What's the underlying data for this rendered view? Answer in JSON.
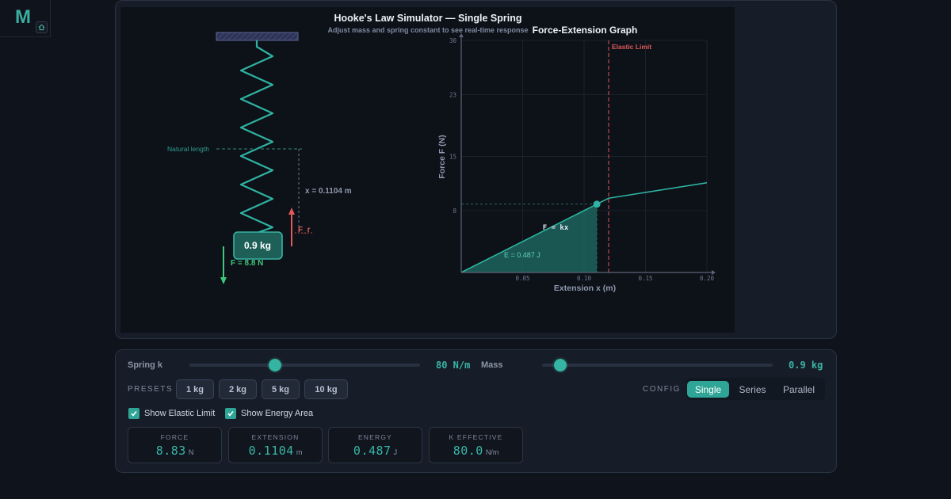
{
  "app": {
    "logo_letter": "M",
    "home_icon": "home-icon"
  },
  "simulation": {
    "title": "Hooke's Law Simulator — Single Spring",
    "subtitle": "Adjust mass and spring constant to see real-time response",
    "natural_length_label": "Natural length",
    "extension_label": "x = 0.1104 m",
    "restoring_force_label": "F_r",
    "mass_label": "0.9 kg",
    "weight_label": "F = 8.8 N",
    "colors": {
      "spring": "#2fb3a2",
      "restoring": "#e05a5a",
      "weight": "#3ec97a",
      "ceiling": "#3a4266"
    }
  },
  "graph": {
    "title": "Force-Extension Graph",
    "xlabel": "Extension x (m)",
    "ylabel": "Force F (N)",
    "elastic_limit_label": "Elastic Limit",
    "formula_label": "F = kx",
    "energy_label": "E = 0.487 J"
  },
  "chart_data": {
    "type": "line",
    "title": "Force-Extension Graph",
    "xlabel": "Extension x (m)",
    "ylabel": "Force F (N)",
    "xlim": [
      0,
      0.2
    ],
    "ylim": [
      0,
      30
    ],
    "xticks": [
      "0.05",
      "0.10",
      "0.15",
      "0.20"
    ],
    "yticks": [
      "8",
      "15",
      "23",
      "30"
    ],
    "elastic_limit_x": 0.12,
    "series": [
      {
        "x": [
          0,
          0.12,
          0.2
        ],
        "y": [
          0,
          9.6,
          11.6
        ]
      }
    ],
    "current_point": {
      "x": 0.1104,
      "y": 8.83
    },
    "energy_area_to_x": 0.1104,
    "grid": true
  },
  "controls": {
    "spring_k_label": "Spring k",
    "spring_k_value": "80 N/m",
    "spring_k_fraction": 0.37,
    "mass_label": "Mass",
    "mass_value": "0.9 kg",
    "mass_fraction": 0.08,
    "presets_label": "PRESETS",
    "presets": [
      "1 kg",
      "2 kg",
      "5 kg",
      "10 kg"
    ],
    "config_label": "CONFIG",
    "config_options": [
      "Single",
      "Series",
      "Parallel"
    ],
    "config_selected": "Single",
    "show_elastic_limit": "Show Elastic Limit",
    "show_energy_area": "Show Energy Area",
    "stats": [
      {
        "label": "FORCE",
        "value": "8.83",
        "unit": "N"
      },
      {
        "label": "EXTENSION",
        "value": "0.1104",
        "unit": "m"
      },
      {
        "label": "ENERGY",
        "value": "0.487",
        "unit": "J"
      },
      {
        "label": "K EFFECTIVE",
        "value": "80.0",
        "unit": "N/m"
      }
    ]
  }
}
